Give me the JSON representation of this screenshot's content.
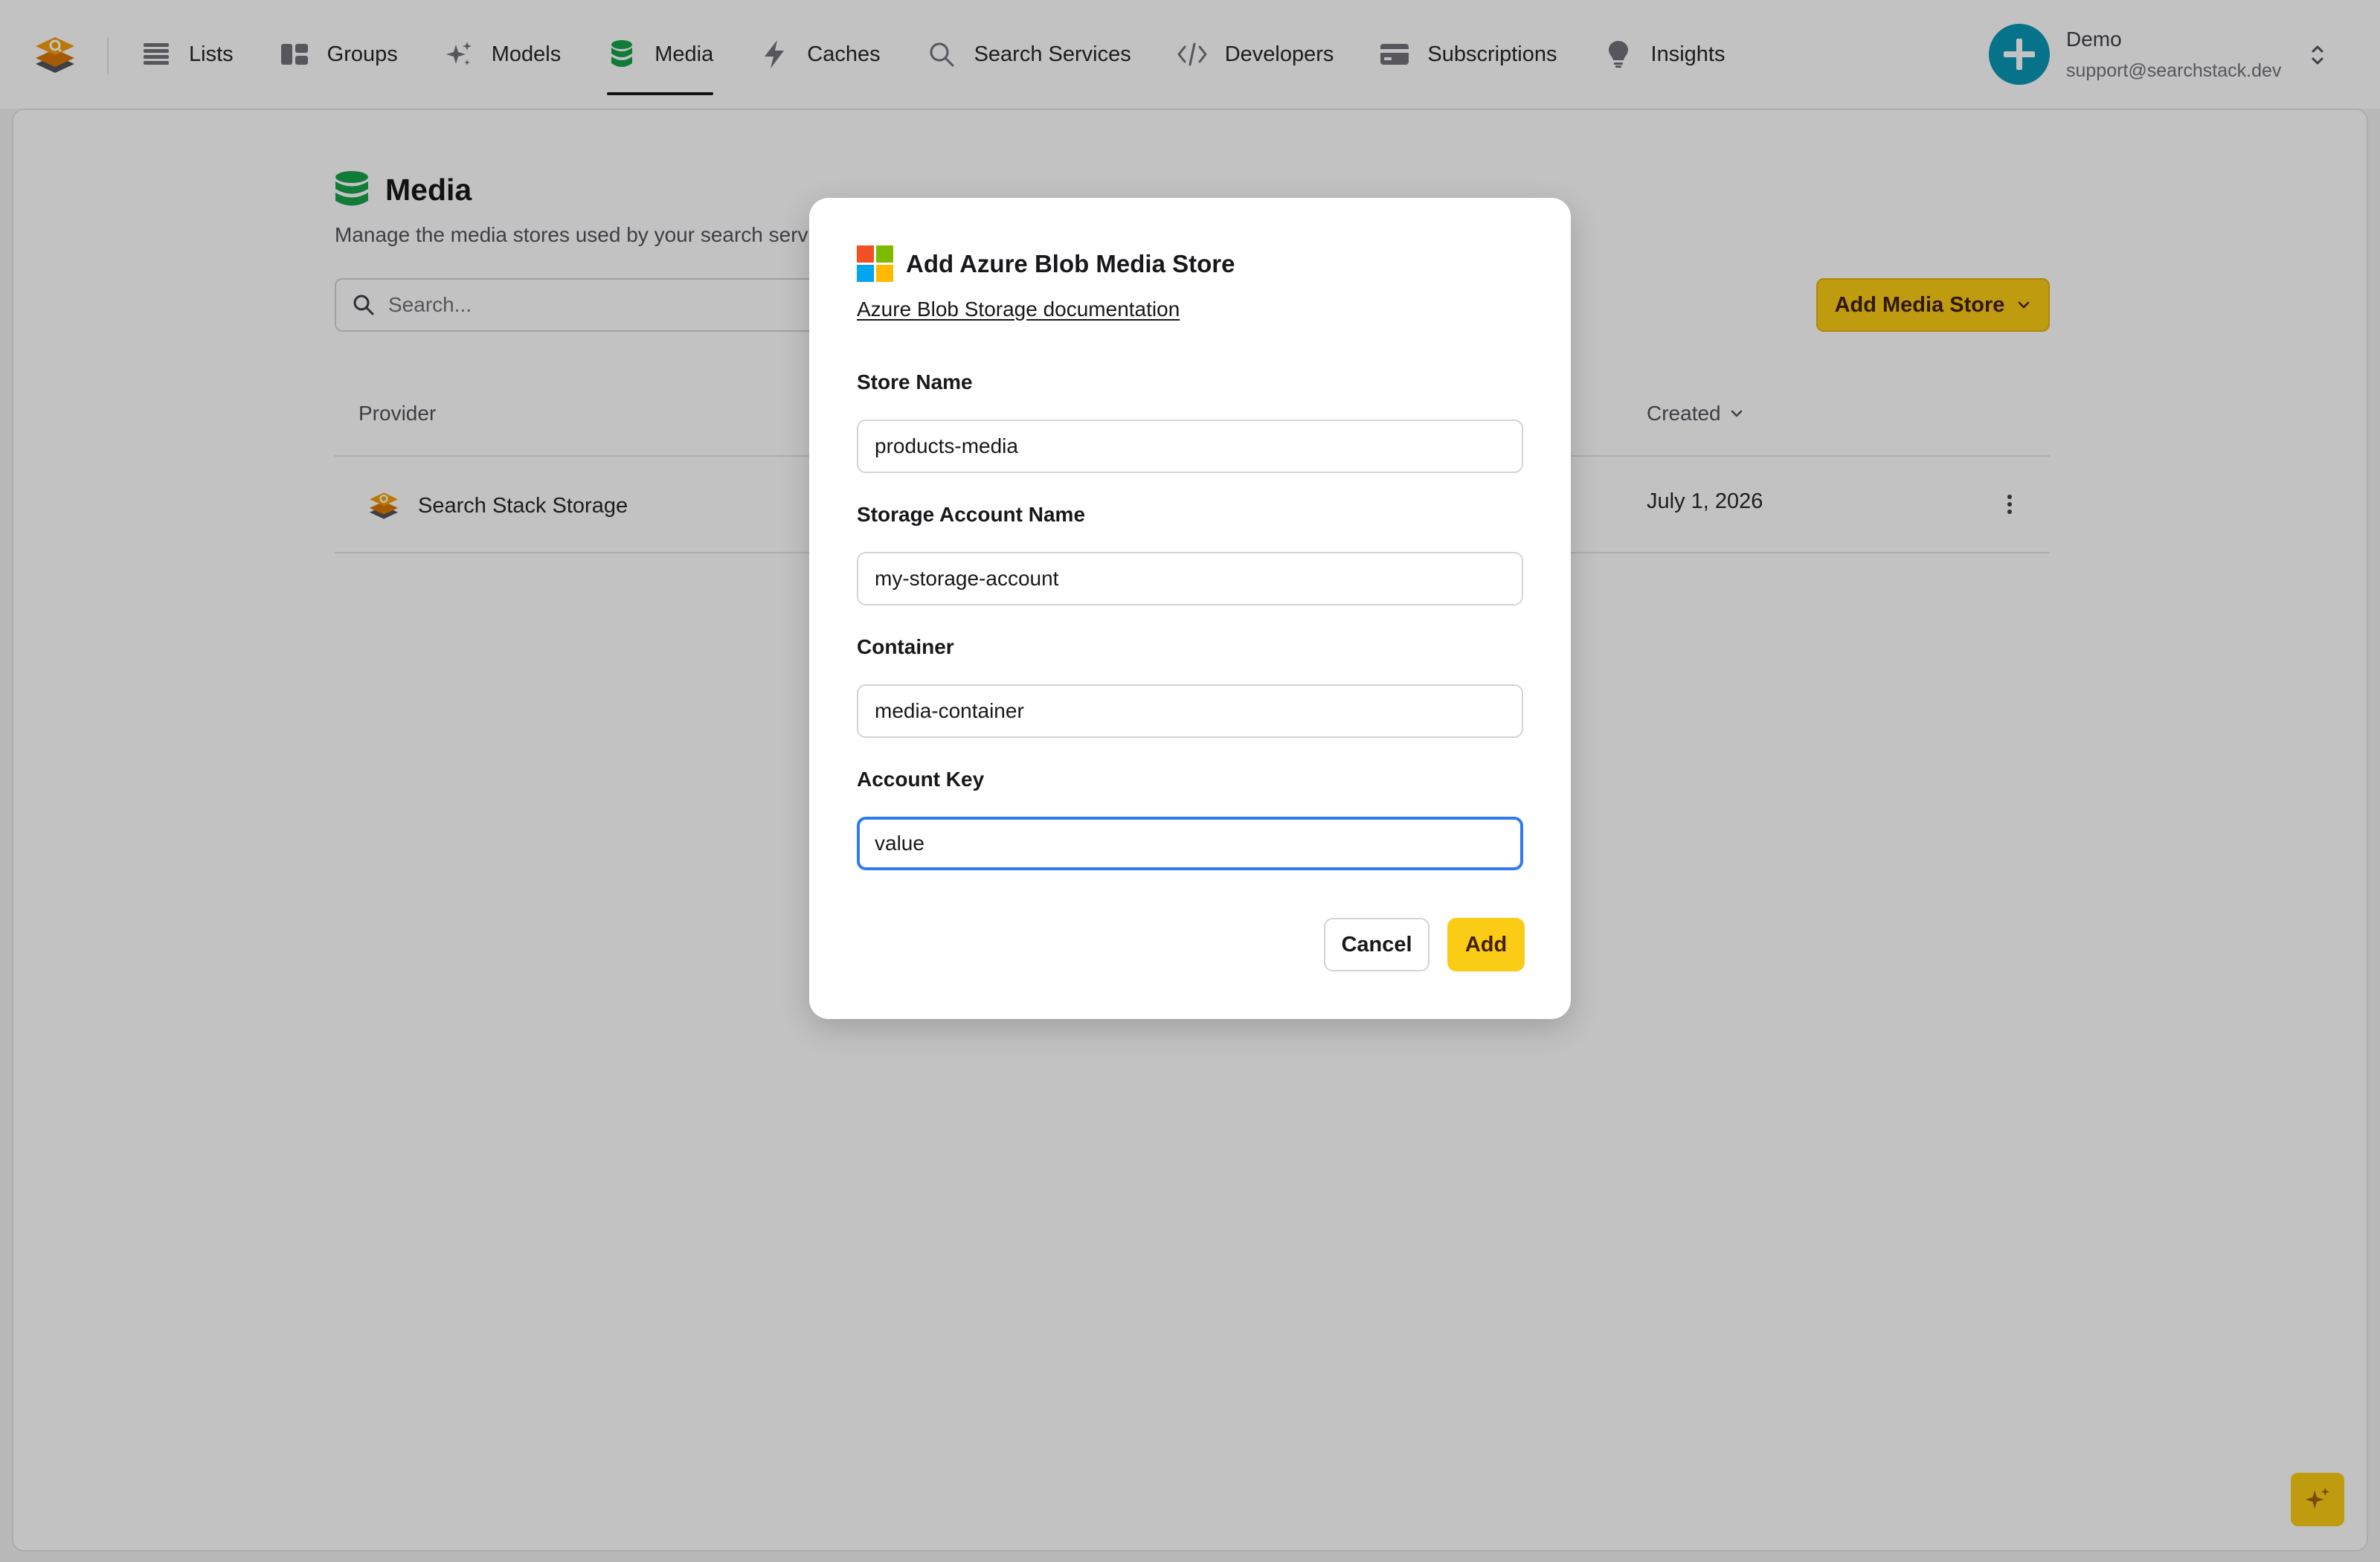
{
  "nav": {
    "items": [
      {
        "label": "Lists",
        "icon": "list-icon"
      },
      {
        "label": "Groups",
        "icon": "groups-icon"
      },
      {
        "label": "Models",
        "icon": "sparkles-icon"
      },
      {
        "label": "Media",
        "icon": "database-icon",
        "active": true
      },
      {
        "label": "Caches",
        "icon": "lightning-icon"
      },
      {
        "label": "Search Services",
        "icon": "search-icon"
      },
      {
        "label": "Developers",
        "icon": "code-icon"
      },
      {
        "label": "Subscriptions",
        "icon": "credit-card-icon"
      },
      {
        "label": "Insights",
        "icon": "lightbulb-icon"
      }
    ]
  },
  "account": {
    "name": "Demo",
    "email": "support@searchstack.dev"
  },
  "page": {
    "title": "Media",
    "subtitle": "Manage the media stores used by your search services.",
    "search_placeholder": "Search...",
    "add_button_label": "Add Media Store"
  },
  "table": {
    "columns": {
      "provider": "Provider",
      "created": "Created"
    },
    "rows": [
      {
        "provider": "Search Stack Storage",
        "created": "July 1, 2026"
      }
    ]
  },
  "modal": {
    "title": "Add Azure Blob Media Store",
    "doc_link": "Azure Blob Storage documentation",
    "fields": [
      {
        "label": "Store Name",
        "value": "products-media"
      },
      {
        "label": "Storage Account Name",
        "value": "my-storage-account"
      },
      {
        "label": "Container",
        "value": "media-container"
      },
      {
        "label": "Account Key",
        "value": "value"
      }
    ],
    "cancel_label": "Cancel",
    "add_label": "Add"
  },
  "colors": {
    "accent": "#facc15",
    "focus": "#2f7bf0",
    "media_green": "#16a34a",
    "avatar": "#0a97b6"
  }
}
